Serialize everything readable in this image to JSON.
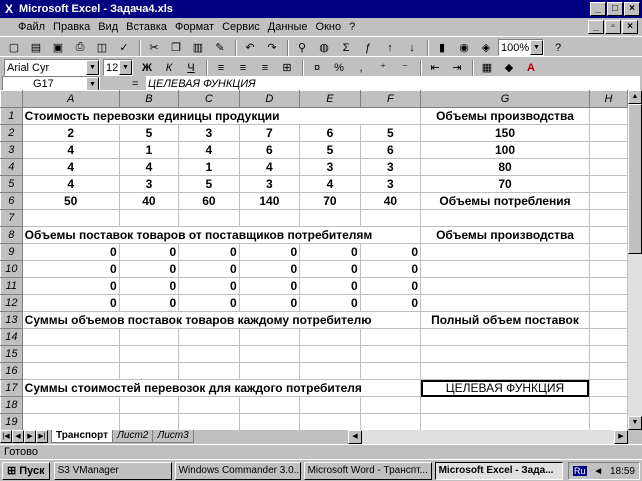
{
  "window": {
    "title": "Microsoft Excel - Задача4.xls"
  },
  "menu": [
    "Файл",
    "Правка",
    "Вид",
    "Вставка",
    "Формат",
    "Сервис",
    "Данные",
    "Окно",
    "?"
  ],
  "toolbar": {
    "zoom": "100%",
    "font": "Arial Cyr",
    "size": "12"
  },
  "formula": {
    "cell": "G17",
    "eq": "=",
    "content": "ЦЕЛЕВАЯ ФУНКЦИЯ"
  },
  "columns": [
    "A",
    "B",
    "C",
    "D",
    "E",
    "F",
    "G",
    "H"
  ],
  "rows": [
    {
      "n": "1",
      "cells": [
        {
          "c": "A",
          "t": "Стоимость перевозки единицы продукции",
          "k": "lbl",
          "span": 6
        },
        {
          "c": "G",
          "t": "Объемы производства",
          "k": "glbl"
        },
        {
          "c": "H",
          "t": ""
        }
      ]
    },
    {
      "n": "2",
      "cells": [
        {
          "t": "2"
        },
        {
          "t": "5"
        },
        {
          "t": "3"
        },
        {
          "t": "7"
        },
        {
          "t": "6"
        },
        {
          "t": "5"
        },
        {
          "t": "150"
        },
        {
          "t": ""
        }
      ]
    },
    {
      "n": "3",
      "cells": [
        {
          "t": "4"
        },
        {
          "t": "1"
        },
        {
          "t": "4"
        },
        {
          "t": "6"
        },
        {
          "t": "5"
        },
        {
          "t": "6"
        },
        {
          "t": "100"
        },
        {
          "t": ""
        }
      ]
    },
    {
      "n": "4",
      "cells": [
        {
          "t": "4"
        },
        {
          "t": "4"
        },
        {
          "t": "1"
        },
        {
          "t": "4"
        },
        {
          "t": "3"
        },
        {
          "t": "3"
        },
        {
          "t": "80"
        },
        {
          "t": ""
        }
      ]
    },
    {
      "n": "5",
      "cells": [
        {
          "t": "4"
        },
        {
          "t": "3"
        },
        {
          "t": "5"
        },
        {
          "t": "3"
        },
        {
          "t": "4"
        },
        {
          "t": "3"
        },
        {
          "t": "70"
        },
        {
          "t": ""
        }
      ]
    },
    {
      "n": "6",
      "cells": [
        {
          "t": "50"
        },
        {
          "t": "40"
        },
        {
          "t": "60"
        },
        {
          "t": "140"
        },
        {
          "t": "70"
        },
        {
          "t": "40"
        },
        {
          "t": "Объемы потребления",
          "k": "glbl"
        },
        {
          "t": ""
        }
      ]
    },
    {
      "n": "7",
      "cells": [
        {
          "t": ""
        },
        {
          "t": ""
        },
        {
          "t": ""
        },
        {
          "t": ""
        },
        {
          "t": ""
        },
        {
          "t": ""
        },
        {
          "t": ""
        },
        {
          "t": ""
        }
      ]
    },
    {
      "n": "8",
      "cells": [
        {
          "t": "Объемы поставок товаров от поставщиков потребителям",
          "k": "lbl",
          "span": 6
        },
        {
          "t": "Объемы производства",
          "k": "glbl"
        },
        {
          "t": ""
        }
      ]
    },
    {
      "n": "9",
      "cells": [
        {
          "t": "0",
          "k": "rnum"
        },
        {
          "t": "0",
          "k": "rnum"
        },
        {
          "t": "0",
          "k": "rnum"
        },
        {
          "t": "0",
          "k": "rnum"
        },
        {
          "t": "0",
          "k": "rnum"
        },
        {
          "t": "0",
          "k": "rnum"
        },
        {
          "t": ""
        },
        {
          "t": ""
        }
      ]
    },
    {
      "n": "10",
      "cells": [
        {
          "t": "0",
          "k": "rnum"
        },
        {
          "t": "0",
          "k": "rnum"
        },
        {
          "t": "0",
          "k": "rnum"
        },
        {
          "t": "0",
          "k": "rnum"
        },
        {
          "t": "0",
          "k": "rnum"
        },
        {
          "t": "0",
          "k": "rnum"
        },
        {
          "t": ""
        },
        {
          "t": ""
        }
      ]
    },
    {
      "n": "11",
      "cells": [
        {
          "t": "0",
          "k": "rnum"
        },
        {
          "t": "0",
          "k": "rnum"
        },
        {
          "t": "0",
          "k": "rnum"
        },
        {
          "t": "0",
          "k": "rnum"
        },
        {
          "t": "0",
          "k": "rnum"
        },
        {
          "t": "0",
          "k": "rnum"
        },
        {
          "t": ""
        },
        {
          "t": ""
        }
      ]
    },
    {
      "n": "12",
      "cells": [
        {
          "t": "0",
          "k": "rnum"
        },
        {
          "t": "0",
          "k": "rnum"
        },
        {
          "t": "0",
          "k": "rnum"
        },
        {
          "t": "0",
          "k": "rnum"
        },
        {
          "t": "0",
          "k": "rnum"
        },
        {
          "t": "0",
          "k": "rnum"
        },
        {
          "t": ""
        },
        {
          "t": ""
        }
      ]
    },
    {
      "n": "13",
      "cells": [
        {
          "t": "Суммы объемов поставок товаров каждому потребителю",
          "k": "lbl",
          "span": 6
        },
        {
          "t": "Полный объем поставок",
          "k": "glbl"
        },
        {
          "t": ""
        }
      ]
    },
    {
      "n": "14",
      "cells": [
        {
          "t": ""
        },
        {
          "t": ""
        },
        {
          "t": ""
        },
        {
          "t": ""
        },
        {
          "t": ""
        },
        {
          "t": ""
        },
        {
          "t": ""
        },
        {
          "t": ""
        }
      ]
    },
    {
      "n": "15",
      "cells": [
        {
          "t": ""
        },
        {
          "t": ""
        },
        {
          "t": ""
        },
        {
          "t": ""
        },
        {
          "t": ""
        },
        {
          "t": ""
        },
        {
          "t": ""
        },
        {
          "t": ""
        }
      ]
    },
    {
      "n": "16",
      "cells": [
        {
          "t": ""
        },
        {
          "t": ""
        },
        {
          "t": ""
        },
        {
          "t": ""
        },
        {
          "t": ""
        },
        {
          "t": ""
        },
        {
          "t": ""
        },
        {
          "t": ""
        }
      ]
    },
    {
      "n": "17",
      "cells": [
        {
          "t": "Суммы стоимостей перевозок для каждого потребителя",
          "k": "lbl",
          "span": 6
        },
        {
          "t": "ЦЕЛЕВАЯ ФУНКЦИЯ",
          "k": "sel"
        },
        {
          "t": ""
        }
      ]
    },
    {
      "n": "18",
      "cells": [
        {
          "t": ""
        },
        {
          "t": ""
        },
        {
          "t": ""
        },
        {
          "t": ""
        },
        {
          "t": ""
        },
        {
          "t": ""
        },
        {
          "t": ""
        },
        {
          "t": ""
        }
      ]
    },
    {
      "n": "19",
      "cells": [
        {
          "t": ""
        },
        {
          "t": ""
        },
        {
          "t": ""
        },
        {
          "t": ""
        },
        {
          "t": ""
        },
        {
          "t": ""
        },
        {
          "t": ""
        },
        {
          "t": ""
        }
      ]
    }
  ],
  "sheets": [
    "Транспорт",
    "Лист2",
    "Лист3"
  ],
  "status": "Готово",
  "taskbar": {
    "start": "Пуск",
    "apps": [
      "S3 VManager",
      "Windows Commander 3.0...",
      "Microsoft Word - Транспт...",
      "Microsoft Excel - Зада..."
    ],
    "lang": "Ru",
    "time": "18:59"
  }
}
